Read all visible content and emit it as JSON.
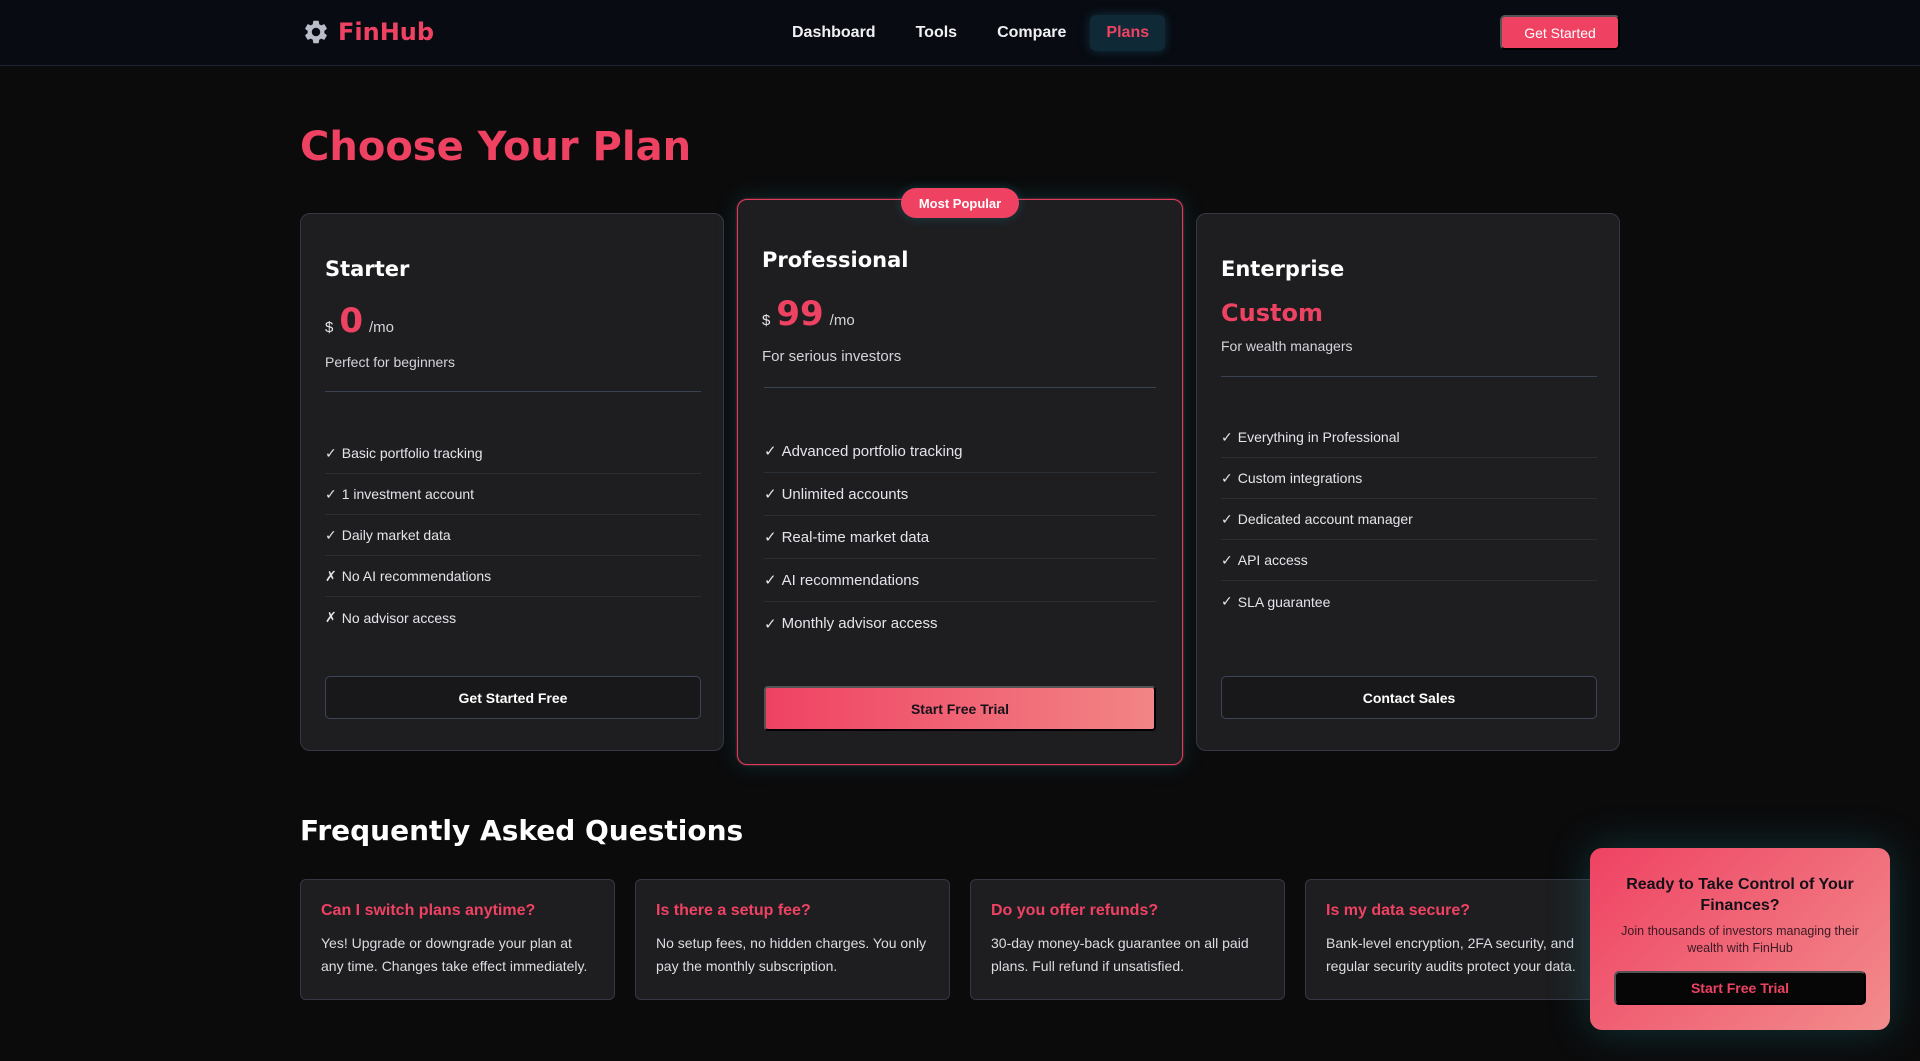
{
  "nav": {
    "brand": "FinHub",
    "links": [
      {
        "label": "Dashboard",
        "active": false
      },
      {
        "label": "Tools",
        "active": false
      },
      {
        "label": "Compare",
        "active": false
      },
      {
        "label": "Plans",
        "active": true
      }
    ],
    "cta_label": "Get Started"
  },
  "page_title": "Choose Your Plan",
  "plans": [
    {
      "name": "Starter",
      "currency": "$",
      "price": "0",
      "period": "/mo",
      "description": "Perfect for beginners",
      "features": [
        {
          "mark": "✓",
          "text": "Basic portfolio tracking"
        },
        {
          "mark": "✓",
          "text": "1 investment account"
        },
        {
          "mark": "✓",
          "text": "Daily market data"
        },
        {
          "mark": "✗",
          "text": "No AI recommendations"
        },
        {
          "mark": "✗",
          "text": "No advisor access"
        }
      ],
      "button_label": "Get Started Free"
    },
    {
      "name": "Professional",
      "badge": "Most Popular",
      "currency": "$",
      "price": "99",
      "period": "/mo",
      "description": "For serious investors",
      "features": [
        {
          "mark": "✓",
          "text": "Advanced portfolio tracking"
        },
        {
          "mark": "✓",
          "text": "Unlimited accounts"
        },
        {
          "mark": "✓",
          "text": "Real-time market data"
        },
        {
          "mark": "✓",
          "text": "AI recommendations"
        },
        {
          "mark": "✓",
          "text": "Monthly advisor access"
        }
      ],
      "button_label": "Start Free Trial"
    },
    {
      "name": "Enterprise",
      "price_text": "Custom",
      "description": "For wealth managers",
      "features": [
        {
          "mark": "✓",
          "text": "Everything in Professional"
        },
        {
          "mark": "✓",
          "text": "Custom integrations"
        },
        {
          "mark": "✓",
          "text": "Dedicated account manager"
        },
        {
          "mark": "✓",
          "text": "API access"
        },
        {
          "mark": "✓",
          "text": "SLA guarantee"
        }
      ],
      "button_label": "Contact Sales"
    }
  ],
  "faq": {
    "title": "Frequently Asked Questions",
    "items": [
      {
        "q": "Can I switch plans anytime?",
        "a": "Yes! Upgrade or downgrade your plan at any time. Changes take effect immediately."
      },
      {
        "q": "Is there a setup fee?",
        "a": "No setup fees, no hidden charges. You only pay the monthly subscription."
      },
      {
        "q": "Do you offer refunds?",
        "a": "30-day money-back guarantee on all paid plans. Full refund if unsatisfied."
      },
      {
        "q": "Is my data secure?",
        "a": "Bank-level encryption, 2FA security, and regular security audits protect your data."
      }
    ]
  },
  "cta_popup": {
    "title": "Ready to Take Control of Your Finances?",
    "subtitle": "Join thousands of investors managing their wealth with FinHub",
    "button_label": "Start Free Trial"
  },
  "colors": {
    "accent": "#ef4263",
    "background": "#0b0b0c",
    "card": "#1e1e21",
    "nav_active_bg": "#0f2a36"
  },
  "icons": {
    "brand": "gear-icon",
    "feature_included": "check-icon",
    "feature_excluded": "cross-icon"
  }
}
